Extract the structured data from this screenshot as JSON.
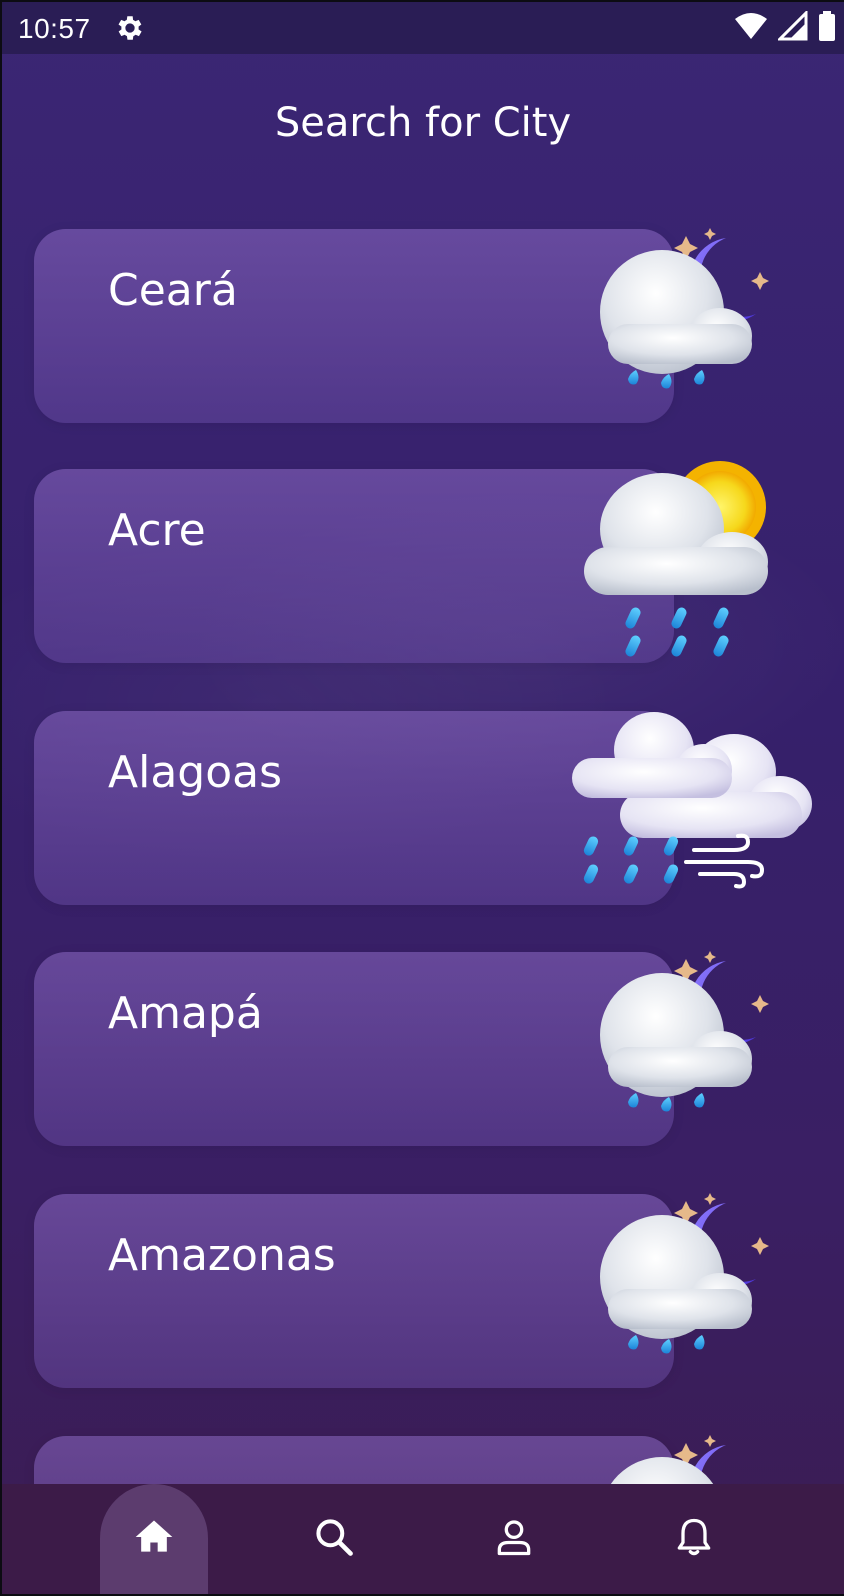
{
  "status_bar": {
    "time": "10:57",
    "icons": [
      "gear-icon",
      "wifi-icon",
      "signal-icon",
      "battery-icon"
    ]
  },
  "header": {
    "title": "Search for City"
  },
  "cities": [
    {
      "name": "Ceará",
      "icon": "night-rain-icon"
    },
    {
      "name": "Acre",
      "icon": "sun-cloud-rain-icon"
    },
    {
      "name": "Alagoas",
      "icon": "clouds-wind-rain-icon"
    },
    {
      "name": "Amapá",
      "icon": "night-rain-icon"
    },
    {
      "name": "Amazonas",
      "icon": "night-rain-icon"
    },
    {
      "name": "",
      "icon": "night-rain-icon"
    }
  ],
  "bottom_nav": {
    "items": [
      {
        "icon": "home-icon",
        "active": true
      },
      {
        "icon": "search-icon",
        "active": false
      },
      {
        "icon": "profile-icon",
        "active": false
      },
      {
        "icon": "bell-icon",
        "active": false
      }
    ]
  },
  "colors": {
    "background": "#36206b",
    "card": "#7a5bb4",
    "status_bar": "#2a1d55",
    "nav_bar": "#3c1b48",
    "nav_active": "#5c3c6e",
    "text": "#ffffff"
  }
}
